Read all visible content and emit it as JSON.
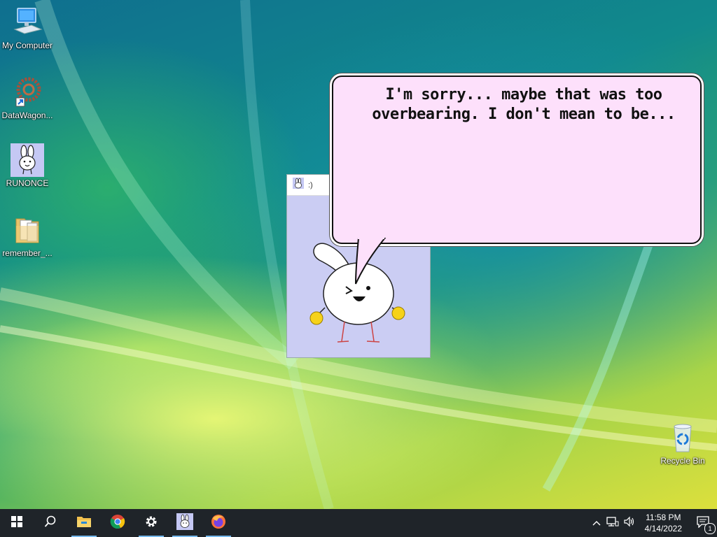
{
  "desktop": {
    "icons": [
      {
        "label": "My Computer",
        "icon": "computer-icon"
      },
      {
        "label": "DataWagon...",
        "icon": "datawagon-icon"
      },
      {
        "label": "RUNONCE",
        "icon": "bunny-icon"
      },
      {
        "label": "remember_...",
        "icon": "folder-icon"
      },
      {
        "label": "Recycle Bin",
        "icon": "recycle-bin-icon"
      }
    ]
  },
  "bunny_window": {
    "title": ":)"
  },
  "speech_bubble": {
    "line1": "I'm sorry... maybe that was too",
    "line2": "overbearing. I don't mean to be..."
  },
  "taskbar": {
    "buttons": [
      {
        "icon": "windows-start-icon"
      },
      {
        "icon": "search-icon"
      },
      {
        "icon": "file-explorer-icon"
      },
      {
        "icon": "chrome-icon"
      },
      {
        "icon": "settings-gear-icon"
      },
      {
        "icon": "bunny-app-icon"
      },
      {
        "icon": "firefox-icon"
      }
    ],
    "clock": {
      "time": "11:58 PM",
      "date": "4/14/2022"
    },
    "notification_count": "1"
  },
  "colors": {
    "taskbar_bg": "#1f2429",
    "bubble_bg": "#fde0fb",
    "window_bg": "#cbcdf3",
    "active_indicator": "#76b9ed"
  }
}
